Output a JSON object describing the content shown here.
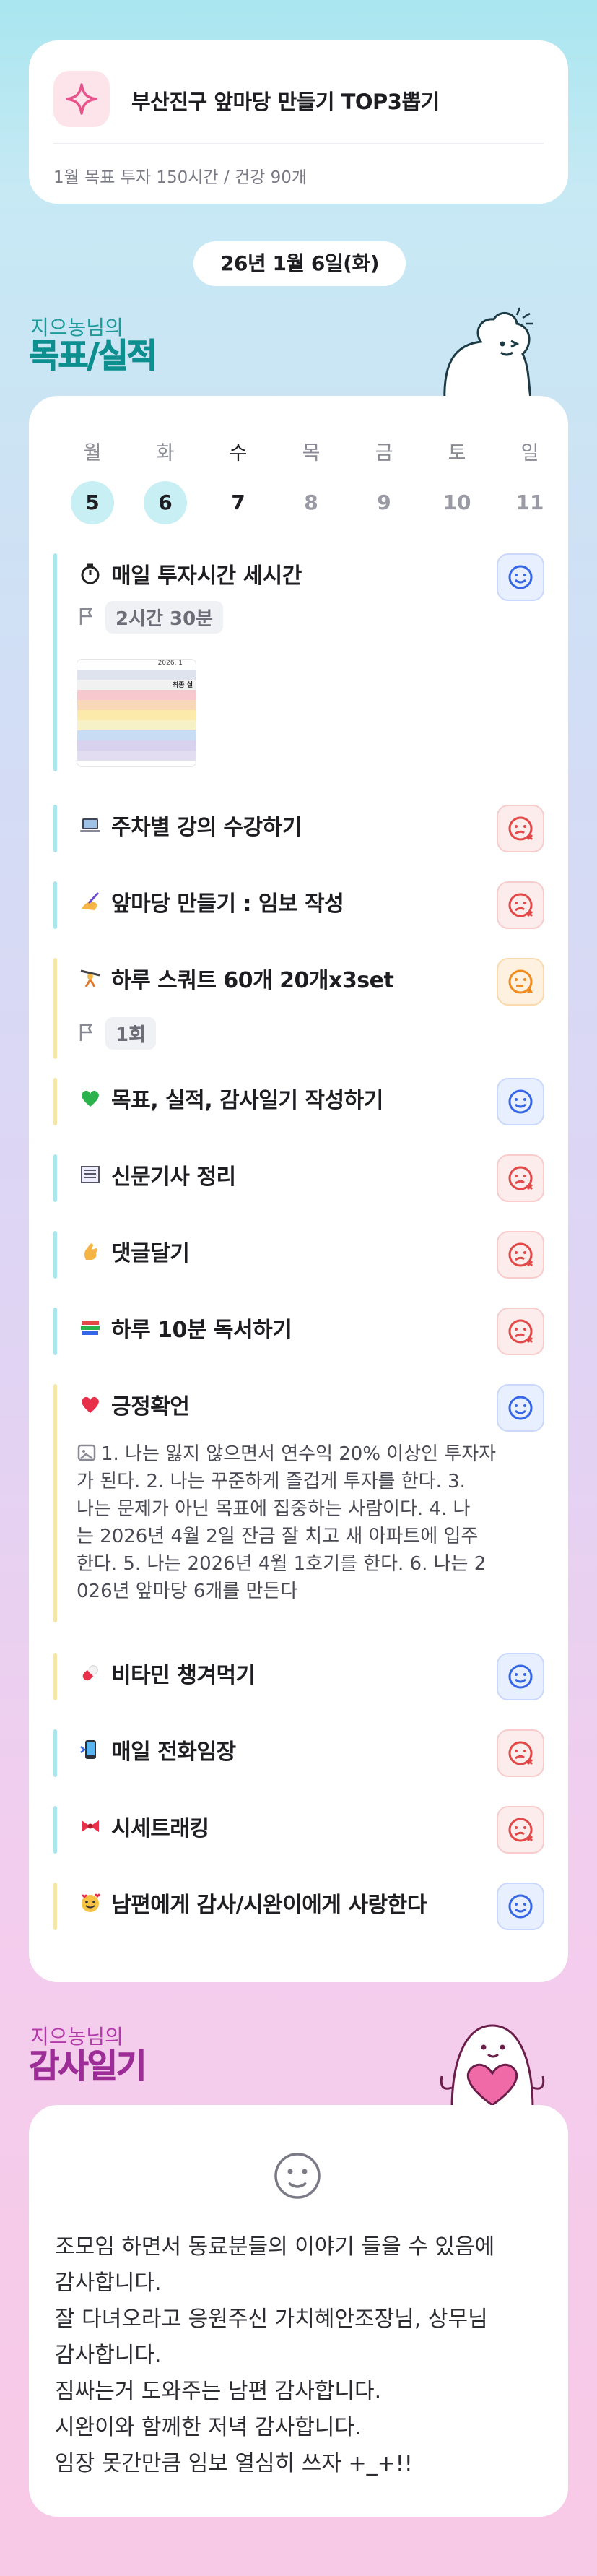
{
  "header": {
    "title": "부산진구 앞마당 만들기 TOP3뽑기",
    "subtitle": "1월 목표  투자 150시간 / 건강 90개"
  },
  "date_label": "26년 1월 6일(화)",
  "goals_section": {
    "owner": "지으농님의",
    "title": "목표/실적"
  },
  "week": [
    {
      "dow": "월",
      "date": "5"
    },
    {
      "dow": "화",
      "date": "6"
    },
    {
      "dow": "수",
      "date": "7"
    },
    {
      "dow": "목",
      "date": "8"
    },
    {
      "dow": "금",
      "date": "9"
    },
    {
      "dow": "토",
      "date": "10"
    },
    {
      "dow": "일",
      "date": "11"
    }
  ],
  "tasks": [
    {
      "emoji": "timer-icon",
      "title": "매일 투자시간 세시간",
      "meta": "2시간 30분",
      "status": "done",
      "bar_color": "#a9e6ef"
    },
    {
      "emoji": "laptop-icon",
      "title": "주차별 강의 수강하기",
      "status": "missed",
      "bar_color": "#a9e6ef"
    },
    {
      "emoji": "writing-hand-icon",
      "title": "앞마당 만들기 : 임보 작성",
      "status": "missed",
      "bar_color": "#a9e6ef"
    },
    {
      "emoji": "weightlifter-icon",
      "title": "하루 스쿼트 60개 20개x3set",
      "meta": "1회",
      "status": "partial",
      "bar_color": "#f6e7a8"
    },
    {
      "emoji": "green-heart-icon",
      "title": "목표, 실적, 감사일기 작성하기",
      "status": "done",
      "bar_color": "#f6e7a8"
    },
    {
      "emoji": "newspaper-icon",
      "title": "신문기사 정리",
      "status": "missed",
      "bar_color": "#a9e6ef"
    },
    {
      "emoji": "pinching-hand-icon",
      "title": "댓글달기",
      "status": "missed",
      "bar_color": "#a9e6ef"
    },
    {
      "emoji": "books-icon",
      "title": "하루 10분 독서하기",
      "status": "missed",
      "bar_color": "#a9e6ef"
    },
    {
      "emoji": "red-heart-icon",
      "title": "긍정확언",
      "status": "done",
      "bar_color": "#f6e7a8",
      "memo": [
        "1. 나는 잃지 않으면서 연수익 20% 이상인 투자자",
        "가 된다. 2. 나는 꾸준하게 즐겁게 투자를 한다. 3.",
        "나는 문제가 아닌 목표에 집중하는 사람이다. 4. 나",
        "는 2026년 4월 2일 잔금 잘 치고 새 아파트에 입주",
        "한다. 5. 나는 2026년 4월 1호기를 한다. 6. 나는 2",
        "026년 앞마당 6개를 만든다"
      ]
    },
    {
      "emoji": "pill-icon",
      "title": "비타민 챙겨먹기",
      "status": "done",
      "bar_color": "#f6e7a8"
    },
    {
      "emoji": "phone-icon",
      "title": "매일 전화임장",
      "status": "missed",
      "bar_color": "#a9e6ef"
    },
    {
      "emoji": "ribbon-icon",
      "title": "시세트래킹",
      "status": "missed",
      "bar_color": "#a9e6ef"
    },
    {
      "emoji": "smiling-hearts-icon",
      "title": "남편에게 감사/시완이에게 사랑한다",
      "status": "done",
      "bar_color": "#f6e7a8"
    }
  ],
  "thumbnail": {
    "header": "2026. 1",
    "label": "최종 실"
  },
  "gratitude_section": {
    "owner": "지으농님의",
    "title": "감사일기"
  },
  "gratitude": [
    "조모임 하면서 동료분들의 이야기 들을 수 있음에",
    "감사합니다.",
    "잘 다녀오라고 응원주신 가치혜안조장님, 상무님",
    "감사합니다.",
    "짐싸는거 도와주는 남편 감사합니다.",
    "시완이와 함께한 저녁 감사합니다.",
    "임장 못간만큼 임보 열심히 쓰자 +_+!!"
  ]
}
